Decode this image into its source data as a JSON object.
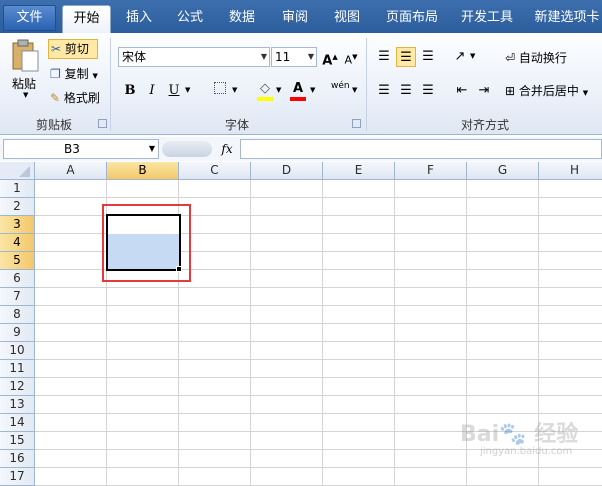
{
  "tabs": {
    "file": "文件",
    "home": "开始",
    "insert": "插入",
    "formulas": "公式",
    "data": "数据",
    "review": "审阅",
    "view": "视图",
    "page_layout": "页面布局",
    "developer": "开发工具",
    "new_tab": "新建选项卡"
  },
  "clipboard": {
    "paste": "粘贴",
    "cut": "剪切",
    "copy": "复制",
    "format_painter": "格式刷",
    "group_label": "剪贴板"
  },
  "font": {
    "name": "宋体",
    "size": "11",
    "bold": "B",
    "italic": "I",
    "underline": "U",
    "grow": "A",
    "shrink": "A",
    "font_color": "A",
    "phonetic": "wén",
    "group_label": "字体"
  },
  "alignment": {
    "wrap_text": "自动换行",
    "merge_center": "合并后居中",
    "group_label": "对齐方式"
  },
  "formula_bar": {
    "name_box": "B3",
    "fx": "fx",
    "value": ""
  },
  "sheet": {
    "columns": [
      "A",
      "B",
      "C",
      "D",
      "E",
      "F",
      "G",
      "H"
    ],
    "rows": [
      "1",
      "2",
      "3",
      "4",
      "5",
      "6",
      "7",
      "8",
      "9",
      "10",
      "11",
      "12",
      "13",
      "14",
      "15",
      "16",
      "17"
    ],
    "selected_column": "B",
    "selected_rows": [
      "3",
      "4",
      "5"
    ],
    "active_cell": "B3",
    "selection": "B3:B5"
  },
  "watermark": {
    "brand": "Bai",
    "brand_suffix": "经验",
    "url": "jingyan.baidu.com"
  },
  "colors": {
    "tab_bar": "#2c5d9c",
    "selection_fill": "#c6dbf3",
    "header_selected": "#f3c86a",
    "annotation_box": "#e23b3b"
  }
}
